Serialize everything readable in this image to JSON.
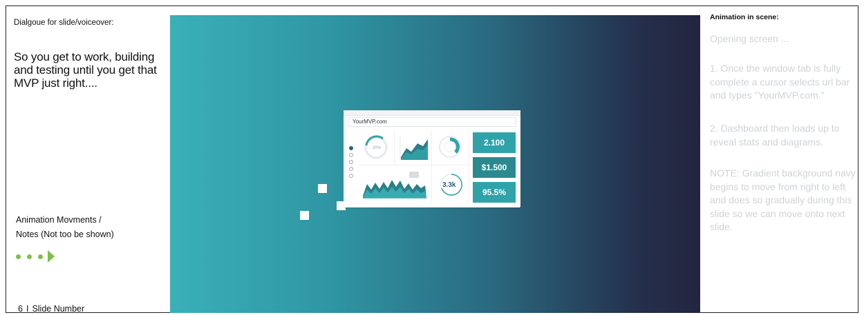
{
  "left": {
    "dialogue_label": "Dialgoue for slide/voiceover:",
    "dialogue_text": "So you get to work, building and testing until you get that MVP just right....",
    "notes_line1": "Animation Movments /",
    "notes_line2": "Notes (Not too be shown)",
    "accent_color": "#7cc243",
    "slide_number": "6",
    "slide_number_label": "Slide Number",
    "separator": "I"
  },
  "slide": {
    "gradient_start": "#3ab0b8",
    "gradient_end": "#23253f",
    "browser": {
      "url": "YourMVP.com",
      "gauge_label": "30%",
      "count_label": "3.3k",
      "stats": [
        "2.100",
        "$1.500",
        "95.5%"
      ]
    }
  },
  "right": {
    "label": "Animation in scene:",
    "opening": "Opening screen ...",
    "step1": "1. Once the window tab is fully complete a cursor selects url bar and types \"YourMVP.com.\"",
    "step2": "2. Dashboard then loads up to reveal stats and diagrams.",
    "note": "NOTE: Gradient background navy begins to move from right to left and does so gradually during this slide so we can move onto next slide."
  }
}
